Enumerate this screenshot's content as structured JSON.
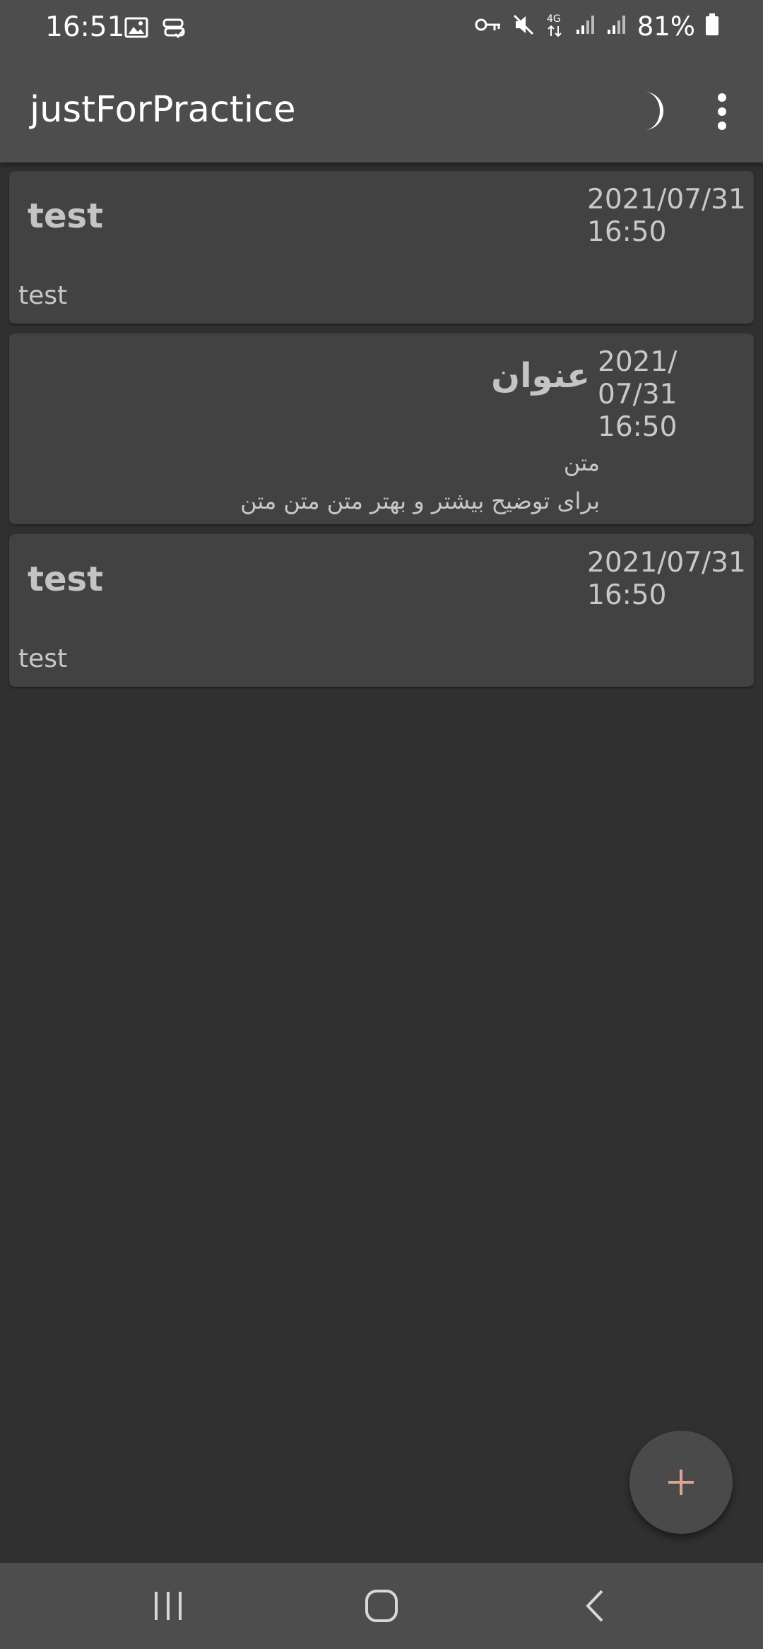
{
  "status_bar": {
    "time": "16:51",
    "battery": "81%",
    "network": "4G",
    "icons": [
      "image-icon",
      "sync-icon",
      "key-icon",
      "mute-icon",
      "signal-icon",
      "signal-icon",
      "battery-icon"
    ]
  },
  "app_bar": {
    "title": "justForPractice",
    "actions": [
      "moon-icon",
      "more-vert-icon"
    ]
  },
  "notes": [
    {
      "title": "test",
      "date": "2021/07/31\n16:50",
      "body": "test"
    },
    {
      "title": "عنوان",
      "date": "2021/\n07/31\n16:50",
      "body_line1": "متن",
      "body_line2": "برای توضیح بیشتر و بهتر متن متن متن"
    },
    {
      "title": "test",
      "date": "2021/07/31\n16:50",
      "body": "test"
    }
  ],
  "fab": {
    "icon": "plus-icon",
    "accent": "#e0a391"
  },
  "nav_bar": {
    "buttons": [
      "recent-apps-icon",
      "home-icon",
      "back-icon"
    ]
  }
}
